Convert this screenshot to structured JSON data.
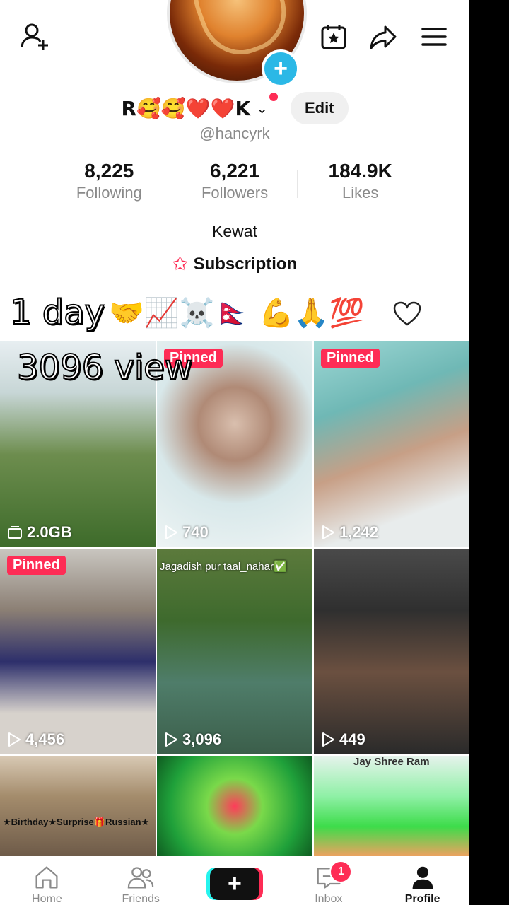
{
  "profile": {
    "display_name": "R🥰🥰❤️❤️K",
    "edit_label": "Edit",
    "handle": "@hancyrk",
    "bio": "Kewat",
    "subscription_label": "Subscription",
    "stats": [
      {
        "value": "8,225",
        "label": "Following"
      },
      {
        "value": "6,221",
        "label": "Followers"
      },
      {
        "value": "184.9K",
        "label": "Likes"
      }
    ]
  },
  "overlay": {
    "caption_text": "1 day",
    "caption_emojis": "🤝📈☠️🇳🇵 💪🙏💯",
    "views_text": "3096 view"
  },
  "videos": [
    {
      "pinned": false,
      "label": "",
      "metric_icon": "storage-icon",
      "metric": "2.0GB",
      "text": ""
    },
    {
      "pinned": true,
      "label": "Pinned",
      "metric_icon": "play-icon",
      "metric": "740",
      "text": ""
    },
    {
      "pinned": true,
      "label": "Pinned",
      "metric_icon": "play-icon",
      "metric": "1,242",
      "text": ""
    },
    {
      "pinned": true,
      "label": "Pinned",
      "metric_icon": "play-icon",
      "metric": "4,456",
      "text": ""
    },
    {
      "pinned": false,
      "label": "",
      "metric_icon": "play-icon",
      "metric": "3,096",
      "text": "Jagadish pur taal_nahar✅"
    },
    {
      "pinned": false,
      "label": "",
      "metric_icon": "play-icon",
      "metric": "449",
      "text": ""
    },
    {
      "pinned": false,
      "label": "",
      "metric_icon": "",
      "metric": "",
      "text": "★Birthday★Surprise🎁Russian★"
    },
    {
      "pinned": false,
      "label": "",
      "metric_icon": "",
      "metric": "",
      "text": ""
    },
    {
      "pinned": false,
      "label": "",
      "metric_icon": "",
      "metric": "",
      "text": "Jay Shree Ram"
    }
  ],
  "nav": {
    "home": "Home",
    "friends": "Friends",
    "inbox": "Inbox",
    "inbox_badge": "1",
    "profile": "Profile"
  },
  "colors": {
    "accent_red": "#fe2c55",
    "accent_cyan": "#25f4ee",
    "avatar_plus": "#2bb8e6"
  }
}
